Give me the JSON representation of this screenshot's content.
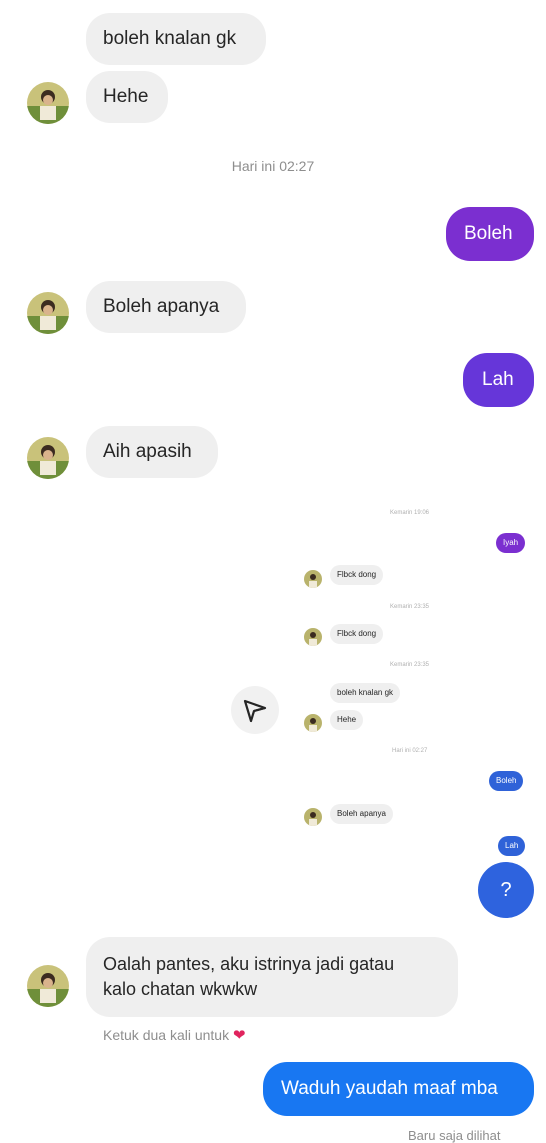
{
  "colors": {
    "bubble_in": "#efefef",
    "purple": "#7b2fd0",
    "violet": "#6636d9",
    "blue": "#1877f2",
    "heart": "#e0245e"
  },
  "chat": {
    "msg1": "boleh knalan gk",
    "msg2": "Hehe",
    "ts1": "Hari ini 02:27",
    "msg3": "Boleh",
    "msg4": "Boleh apanya",
    "msg5": "Lah",
    "msg6": "Aih apasih",
    "msg7_line1": "Oalah pantes, aku istrinya jadi gatau",
    "msg7_line2": "kalo chatan wkwkw",
    "reaction_hint": "Ketuk dua kali untuk",
    "heart_icon": "heart-icon",
    "msg8": "Waduh yaudah maaf mba",
    "seen": "Baru saja dilihat"
  },
  "embedded": {
    "ts_a": "Kemarin 19:06",
    "m1": "Iyah",
    "m2": "Flbck dong",
    "ts_b": "Kemarin 23:35",
    "m3": "Flbck dong",
    "ts_c": "Kemarin 23:35",
    "m4": "boleh knalan gk",
    "m5": "Hehe",
    "ts_d": "Hari ini 02:27",
    "m6": "Boleh",
    "m7": "Boleh apanya",
    "m8": "Lah",
    "help": "?",
    "send_icon": "send-icon"
  }
}
